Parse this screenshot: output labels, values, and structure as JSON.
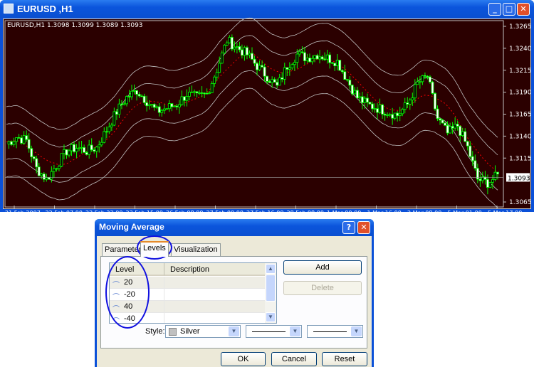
{
  "window": {
    "title": "EURUSD ,H1",
    "info": "EURUSD,H1  1.3098 1.3099 1.3089 1.3093",
    "buttons": [
      "minimize",
      "maximize",
      "close"
    ]
  },
  "chart_data": {
    "type": "candlestick",
    "symbol": "EURUSD",
    "timeframe": "H1",
    "ohlc_last": {
      "open": 1.3098,
      "high": 1.3099,
      "low": 1.3089,
      "close": 1.3093
    },
    "current_price_label": "1.3093",
    "ylim": [
      1.3055,
      1.328
    ],
    "y_ticks": [
      "1.3265",
      "1.3240",
      "1.3215",
      "1.3190",
      "1.3165",
      "1.3140",
      "1.3115",
      "1.3065"
    ],
    "x_ticks": [
      "21 Feb 2007",
      "22 Feb 07:00",
      "22 Feb 23:00",
      "23 Feb 15:00",
      "26 Feb 08:00",
      "27 Feb 00:00",
      "27 Feb 16:00",
      "28 Feb 08:00",
      "1 Mar 00:00",
      "1 Mar 16:00",
      "2 Mar 08:00",
      "5 Mar 01:00",
      "5 Mar 17:00"
    ],
    "closes_approx": [
      1.3131,
      1.3139,
      1.3135,
      1.3103,
      1.3091,
      1.3107,
      1.3123,
      1.3127,
      1.3123,
      1.3127,
      1.3147,
      1.3168,
      1.3184,
      1.3192,
      1.318,
      1.3168,
      1.3172,
      1.3176,
      1.3188,
      1.3184,
      1.3188,
      1.3216,
      1.3249,
      1.3241,
      1.3233,
      1.322,
      1.3208,
      1.3196,
      1.322,
      1.3233,
      1.3229,
      1.3233,
      1.3229,
      1.3225,
      1.3204,
      1.3184,
      1.3176,
      1.3172,
      1.3168,
      1.3164,
      1.3176,
      1.32,
      1.3208,
      1.316,
      1.3143,
      1.3152,
      1.3127,
      1.3091,
      1.3087,
      1.3095
    ],
    "ma_color": "#ff0000",
    "band_color": "#c0c0c0",
    "candle_color": "#00ff00",
    "background": "#2b0000"
  },
  "dialog": {
    "title": "Moving Average",
    "tabs": [
      "Parameters",
      "Levels",
      "Visualization"
    ],
    "active_tab": "Levels",
    "columns": [
      "Level",
      "Description"
    ],
    "levels": [
      {
        "level": "20",
        "description": ""
      },
      {
        "level": "-20",
        "description": ""
      },
      {
        "level": "40",
        "description": ""
      },
      {
        "level": "-40",
        "description": ""
      }
    ],
    "add": "Add",
    "delete": "Delete",
    "style_label": "Style:",
    "color_value": "Silver",
    "ok": "OK",
    "cancel": "Cancel",
    "reset": "Reset"
  }
}
